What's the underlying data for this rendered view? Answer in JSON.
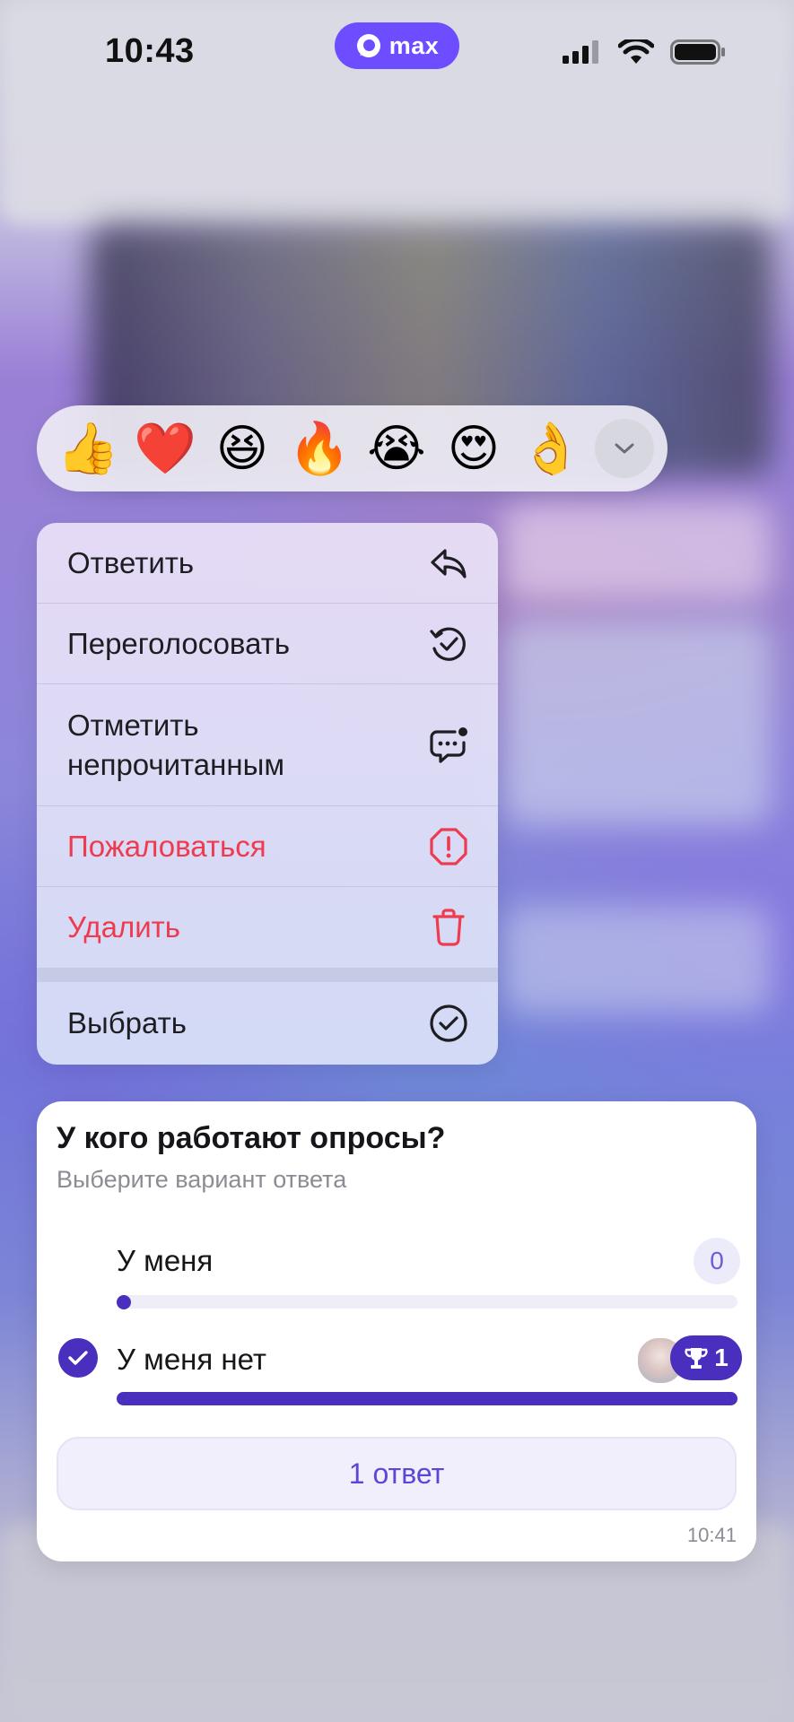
{
  "status_bar": {
    "time": "10:43",
    "app_pill_label": "max",
    "icons": [
      "signal-icon",
      "wifi-icon",
      "battery-icon"
    ]
  },
  "reactions": {
    "items": [
      {
        "emoji": "👍",
        "name": "thumbs-up"
      },
      {
        "emoji": "❤️",
        "name": "red-heart"
      },
      {
        "emoji": "😆",
        "name": "laughing-face"
      },
      {
        "emoji": "🔥",
        "name": "fire"
      },
      {
        "emoji": "😭",
        "name": "crying-face"
      },
      {
        "emoji": "😍",
        "name": "heart-eyes"
      },
      {
        "emoji": "👌",
        "name": "ok-hand"
      }
    ],
    "expand_icon": "chevron-down-icon"
  },
  "menu": {
    "reply": "Ответить",
    "revote": "Переголосовать",
    "mark_unread_line1": "Отметить",
    "mark_unread_line2": "непрочитанным",
    "report": "Пожаловаться",
    "delete": "Удалить",
    "select": "Выбрать",
    "danger_color": "#ee3b4f"
  },
  "poll": {
    "question": "У кого работают опросы?",
    "hint": "Выберите вариант ответа",
    "options": [
      {
        "label": "У меня",
        "votes": "0",
        "share": 0.0,
        "selected": false
      },
      {
        "label": "У меня нет",
        "votes": "1",
        "share": 1.0,
        "selected": true,
        "winner": true
      }
    ],
    "answers_button": "1 ответ",
    "time": "10:41",
    "accent_color": "#4a2fbf"
  }
}
